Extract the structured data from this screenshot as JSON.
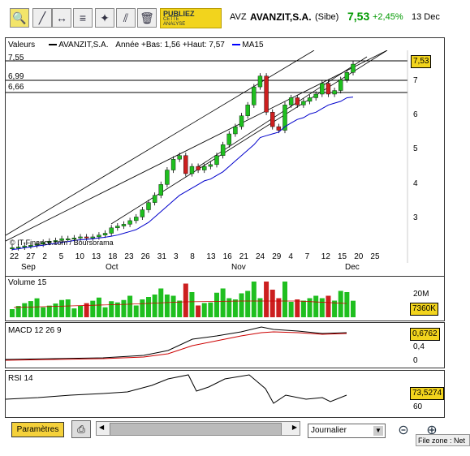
{
  "toolbar": {
    "tools": [
      "zoom-tool",
      "draw-line-tool",
      "horizontal-line-tool",
      "fibonacci-tool",
      "move-tool",
      "cross-tool",
      "delete-tool"
    ],
    "ad_line1": "PUBLIEZ",
    "ad_line2": "CETTE",
    "ad_line3": "ANALYSE"
  },
  "quote": {
    "symbol": "AVZ",
    "name": "AVANZIT,S.A.",
    "market": "(Sibe)",
    "price": "7,53",
    "change": "+2,45%",
    "date": "13 Dec",
    "colors": {
      "up": "#009900"
    }
  },
  "main_panel": {
    "legend_label": "Valeurs",
    "legend_series": "AVANZIT,S.A.",
    "legend_range": "Année +Bas: 1,56 +Haut: 7,57",
    "legend_ma": "MA15",
    "levels": [
      "7,55",
      "6,99",
      "6,66"
    ],
    "price_box": "7,53",
    "y_ticks": [
      "7",
      "6",
      "5",
      "4",
      "3"
    ],
    "copyright": "© IT-Finance.com / Boursorama",
    "x_days": [
      "22",
      "27",
      "2",
      "5",
      "10",
      "13",
      "18",
      "23",
      "26",
      "31",
      "3",
      "8",
      "13",
      "16",
      "21",
      "24",
      "29",
      "4",
      "7",
      "12",
      "15",
      "20",
      "25"
    ],
    "x_months": [
      "Sep",
      "Oct",
      "Nov",
      "Dec"
    ]
  },
  "volume_panel": {
    "label": "Volume 15",
    "tick": "20M",
    "value_box": "7360K"
  },
  "macd_panel": {
    "label": "MACD 12 26 9",
    "tick": "0,4",
    "tick0": "0",
    "value_box": "0,6762"
  },
  "rsi_panel": {
    "label": "RSI 14",
    "tick": "60",
    "value_box": "73,5274"
  },
  "bottom": {
    "params_label": "Paramètres",
    "period_select": "Journalier",
    "tooltip": "File zone : Net"
  },
  "chart_data": {
    "type": "line",
    "title": "",
    "xlabel": "",
    "ylabel": "",
    "ylim": [
      2.3,
      7.8
    ],
    "series": [
      {
        "name": "AVANZIT,S.A.",
        "values": [
          2.45,
          2.47,
          2.5,
          2.52,
          2.55,
          2.6,
          2.63,
          2.65,
          2.7,
          2.7,
          2.72,
          2.75,
          2.72,
          2.75,
          2.8,
          2.85,
          3.0,
          3.05,
          3.1,
          3.2,
          3.3,
          3.5,
          3.7,
          3.9,
          4.2,
          4.6,
          4.9,
          5.0,
          4.5,
          4.7,
          4.6,
          4.7,
          4.75,
          5.0,
          5.3,
          5.6,
          5.8,
          6.1,
          6.4,
          6.9,
          7.2,
          6.2,
          5.8,
          5.7,
          6.4,
          6.6,
          6.4,
          6.5,
          6.6,
          6.7,
          7.0,
          6.7,
          6.8,
          7.1,
          7.3,
          7.53
        ]
      },
      {
        "name": "MA15",
        "values": [
          2.4,
          2.42,
          2.45,
          2.47,
          2.5,
          2.52,
          2.55,
          2.57,
          2.6,
          2.62,
          2.65,
          2.67,
          2.68,
          2.7,
          2.72,
          2.74,
          2.77,
          2.8,
          2.85,
          2.9,
          2.95,
          3.05,
          3.15,
          3.3,
          3.45,
          3.6,
          3.75,
          3.9,
          4.0,
          4.1,
          4.2,
          4.3,
          4.35,
          4.45,
          4.55,
          4.7,
          4.85,
          5.0,
          5.15,
          5.3,
          5.5,
          5.55,
          5.6,
          5.65,
          5.8,
          5.9,
          6.0,
          6.05,
          6.15,
          6.2,
          6.3,
          6.4,
          6.45,
          6.5,
          6.6,
          6.62
        ]
      }
    ]
  }
}
